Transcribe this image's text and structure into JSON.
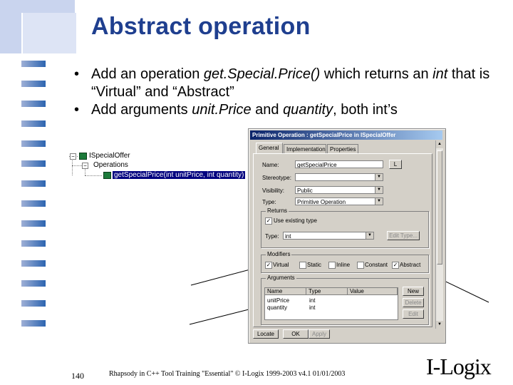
{
  "slide": {
    "title": "Abstract operation",
    "bullets": [
      {
        "parts": [
          {
            "t": "Add an operation ",
            "i": false
          },
          {
            "t": "get.Special.Price()",
            "i": true
          },
          {
            "t": " which returns an ",
            "i": false
          },
          {
            "t": "int",
            "i": true
          },
          {
            "t": " that is “Virtual” and “Abstract”",
            "i": false
          }
        ]
      },
      {
        "parts": [
          {
            "t": "Add arguments ",
            "i": false
          },
          {
            "t": "unit.Price",
            "i": true
          },
          {
            "t": " and ",
            "i": false
          },
          {
            "t": "quantity",
            "i": true
          },
          {
            "t": ", both int’s",
            "i": false
          }
        ]
      }
    ],
    "bullet_char": "•",
    "page_number": "140",
    "footer": "Rhapsody in C++ Tool Training \"Essential\"  © I-Logix 1999-2003   v4.1  01/01/2003",
    "logo": "I-Logix"
  },
  "tree": {
    "root_label": "ISpecialOffer",
    "folder_label": "Operations",
    "item_label": "getSpecialPrice(int unitPrice, int quantity)"
  },
  "dialog": {
    "title": "Primitive Operation : getSpecialPrice in ISpecialOffer",
    "tabs": [
      "General",
      "Implementation",
      "Properties"
    ],
    "name_label": "Name:",
    "name_value": "getSpecialPrice",
    "l_button": "L",
    "stereotype_label": "Stereotype:",
    "stereotype_value": "",
    "visibility_label": "Visibility:",
    "visibility_value": "Public",
    "type_label": "Type:",
    "type_value": "Primitive Operation",
    "returns_title": "Returns",
    "use_existing_label": "Use existing type",
    "returns_type_label": "Type:",
    "returns_type_value": "int",
    "edit_type_button": "Edit Type...",
    "modifiers_title": "Modifiers",
    "modifiers": [
      {
        "label": "Virtual",
        "checked": true
      },
      {
        "label": "Static",
        "checked": false
      },
      {
        "label": "Inline",
        "checked": false
      },
      {
        "label": "Constant",
        "checked": false
      },
      {
        "label": "Abstract",
        "checked": true
      }
    ],
    "arguments_title": "Arguments",
    "columns": [
      "Name",
      "Type",
      "Value"
    ],
    "rows": [
      {
        "name": "unitPrice",
        "type": "int",
        "value": ""
      },
      {
        "name": "quantity",
        "type": "int",
        "value": ""
      }
    ],
    "new_button": "New",
    "delete_button": "Delete",
    "edit_button": "Edit",
    "locate_button": "Locate",
    "ok_button": "OK",
    "apply_button": "Apply"
  }
}
